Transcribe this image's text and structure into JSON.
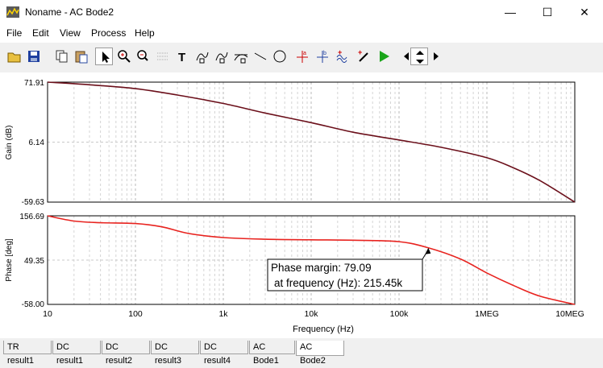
{
  "window": {
    "title": "Noname - AC Bode2",
    "minimize": "—",
    "maximize": "☐",
    "close": "✕"
  },
  "menu": [
    "File",
    "Edit",
    "View",
    "Process",
    "Help"
  ],
  "toolbar": [
    "open-icon",
    "save-icon",
    "copy-icon",
    "paste-icon",
    "select-arrow-icon",
    "zoom-in-icon",
    "zoom-100-icon",
    "grid-icon",
    "text-icon",
    "curve-tool-icon",
    "curve-tool2-icon",
    "tangent-icon",
    "line-icon",
    "circle-icon",
    "cursor-a-icon",
    "cursor-b-icon",
    "add-wave-icon",
    "add-probe-icon",
    "run-icon",
    "scroll-left-icon",
    "scroll-updown-icon",
    "scroll-right-icon"
  ],
  "chart_data": [
    {
      "type": "line",
      "ylabel": "Gain (dB)",
      "yticks": [
        "71.91",
        "6.14",
        "-59.63"
      ],
      "ylim": [
        -59.63,
        71.91
      ],
      "xscale": "log",
      "xlim": [
        10,
        10000000
      ],
      "series": [
        {
          "color": "#6b0f1a",
          "x": [
            10,
            30,
            100,
            300,
            1000,
            3000,
            10000,
            30000,
            100000,
            300000,
            1000000,
            2000000,
            4000000,
            10000000
          ],
          "y": [
            71.9,
            69.0,
            64.8,
            57.8,
            48.5,
            38.0,
            27.5,
            17.0,
            8.5,
            0.5,
            -11.0,
            -22.0,
            -36.0,
            -59.6
          ]
        }
      ]
    },
    {
      "type": "line",
      "ylabel": "Phase [deg]",
      "yticks": [
        "156.69",
        "49.35",
        "-58.00"
      ],
      "ylim": [
        -58.0,
        156.69
      ],
      "xscale": "log",
      "xlim": [
        10,
        10000000
      ],
      "xlabel": "Frequency (Hz)",
      "xticks": [
        "10",
        "100",
        "1k",
        "10k",
        "100k",
        "1MEG",
        "10MEG"
      ],
      "series": [
        {
          "color": "#e8231f",
          "x": [
            10,
            20,
            40,
            100,
            200,
            400,
            1000,
            3000,
            10000,
            30000,
            100000,
            215450,
            500000,
            1000000,
            2000000,
            4000000,
            10000000
          ],
          "y": [
            156.7,
            144.0,
            140.0,
            138.0,
            130.0,
            114.0,
            104.0,
            100.0,
            98.5,
            97.5,
            94.0,
            79.09,
            52.0,
            18.0,
            -12.0,
            -38.0,
            -58.0
          ]
        }
      ],
      "annotation": {
        "line1": "Phase margin: 79.09",
        "line2": "at frequency (Hz): 215.45k",
        "x": 215450,
        "y": 79.09
      }
    }
  ],
  "tabs": [
    {
      "label": "TR result1",
      "active": false
    },
    {
      "label": "DC result1",
      "active": false
    },
    {
      "label": "DC result2",
      "active": false
    },
    {
      "label": "DC result3",
      "active": false
    },
    {
      "label": "DC result4",
      "active": false
    },
    {
      "label": "AC Bode1",
      "active": false
    },
    {
      "label": "AC Bode2",
      "active": true
    }
  ]
}
